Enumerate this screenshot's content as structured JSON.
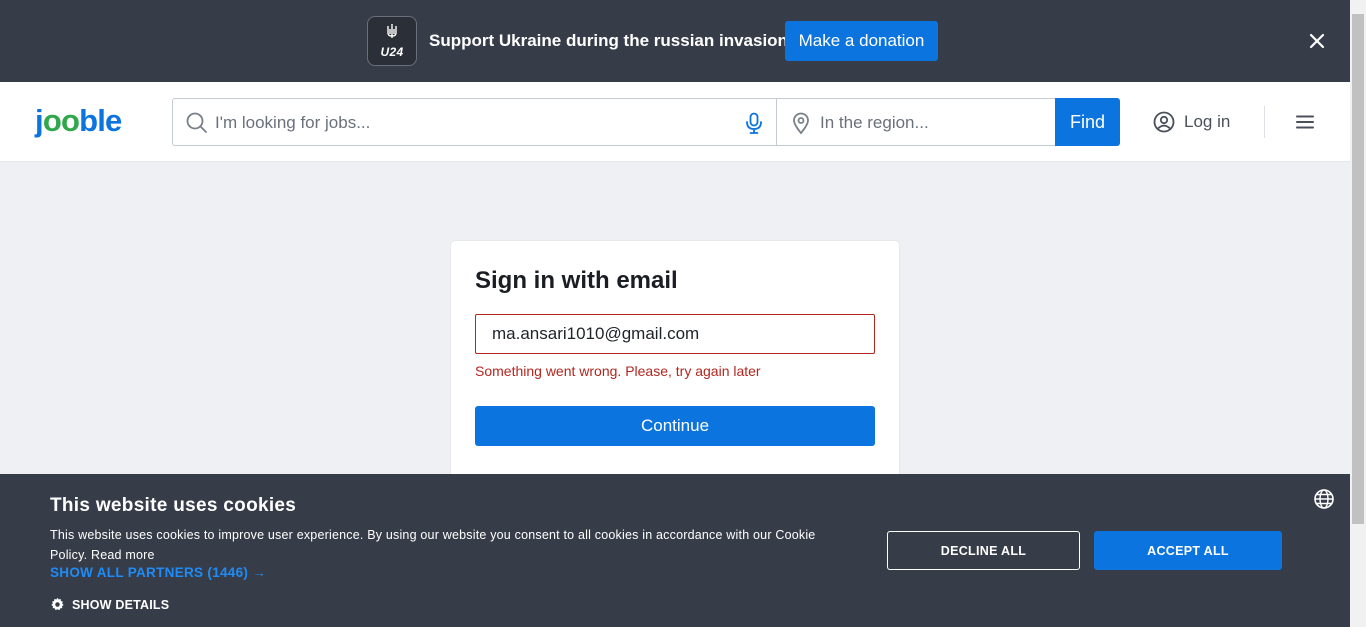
{
  "ua_banner": {
    "logo_text": "U24",
    "message": "Support Ukraine during the russian invasion",
    "donate_label": "Make a donation"
  },
  "header": {
    "logo": {
      "j": "j",
      "oo": "oo",
      "ble": "ble"
    },
    "search_placeholder": "I'm looking for jobs...",
    "region_placeholder": "In the region...",
    "find_label": "Find",
    "login_label": "Log in"
  },
  "signin": {
    "title": "Sign in with email",
    "email_value": "ma.ansari1010@gmail.com",
    "error": "Something went wrong. Please, try again later",
    "continue_label": "Continue"
  },
  "cookies": {
    "title": "This website uses cookies",
    "text": "This website uses cookies to improve user experience. By using our website you consent to all cookies in accordance with our Cookie Policy.",
    "read_more": "Read more",
    "partners_link": "SHOW ALL PARTNERS (1446) →",
    "show_details": "SHOW DETAILS",
    "decline_label": "DECLINE ALL",
    "accept_label": "ACCEPT ALL"
  },
  "colors": {
    "brand_blue": "#0b74de",
    "brand_green": "#2ea84a",
    "banner_bg": "#373d48",
    "error_red": "#b3261e"
  },
  "icons": [
    "ukraine-trident-icon",
    "close-icon",
    "search-icon",
    "microphone-icon",
    "location-pin-icon",
    "user-circle-icon",
    "hamburger-menu-icon",
    "gear-icon",
    "globe-icon"
  ]
}
